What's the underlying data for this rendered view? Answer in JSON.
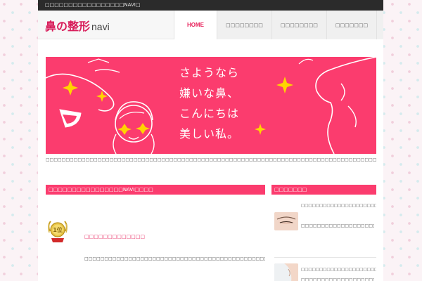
{
  "topbar": {
    "text": "□□□□□□□□□□□□□□□□□NAVI□"
  },
  "header": {
    "logo_title": "鼻の整形",
    "logo_sub": "navi",
    "nav": [
      {
        "label": "HOME",
        "active": true
      },
      {
        "label": "□□□□□□□□"
      },
      {
        "label": "□□□□□□□□"
      },
      {
        "label": "□□□□□□□"
      },
      {
        "label": "□□□□□"
      }
    ]
  },
  "banner": {
    "lines": [
      "さようなら",
      "嫌いな鼻、",
      "こんにちは",
      "美しい私。"
    ]
  },
  "intro": {
    "text": "□□□□□□□□□□□□□□□□□□□□□□□□□□□□□□□□□□□□□□□□□□□□□□□□□□□□□□□□□□□□□□□□□□□□□□□□□□□□□□□□□□□□□□□□□□□□□□□□□□□□□□□□□□□□□□□□□□□□□□□□□□□□□□□□□□□□□□□□□□□□□□□□□□□□□□□□□□□□□□□□□□□□□□□□□□□□□□□□□□"
  },
  "main_section": {
    "title": "□□□□□□□□□□□□□□□□NAVI□□□□",
    "rank_label": "1位",
    "item_title": "□□□□□□□□□□□□□",
    "item_desc": "□□□□□□□□□□□□□□□□□□□□□□□□□□□□□□□□□□□□□□□□□□□□□□□□□□□□□□□□□□□□□□□□□□□□□□□□□□□□□□□□□□□□□□□□□□"
  },
  "sidebar": {
    "title": "□□□□□□□",
    "items": [
      {
        "title": "□□□□□□□□□□□□□□□□□□□□□□□□□□□□□",
        "text": "□□□□□□□□□□□□□□□□□□□□□□□□□□□□□□□□□□□□□□□□□□□□□□□□□□□□□□□□□□□□□□□□□□"
      },
      {
        "title": "□□□□□□□□□□□□□□□□□□□□□□□□",
        "text": "□□□□□□□□□□□□□□□□□□□□□□□□□□□□□□□□"
      }
    ]
  },
  "colors": {
    "accent": "#fb3c6e",
    "logo": "#d81e5b",
    "topbar": "#2b2b2b"
  }
}
